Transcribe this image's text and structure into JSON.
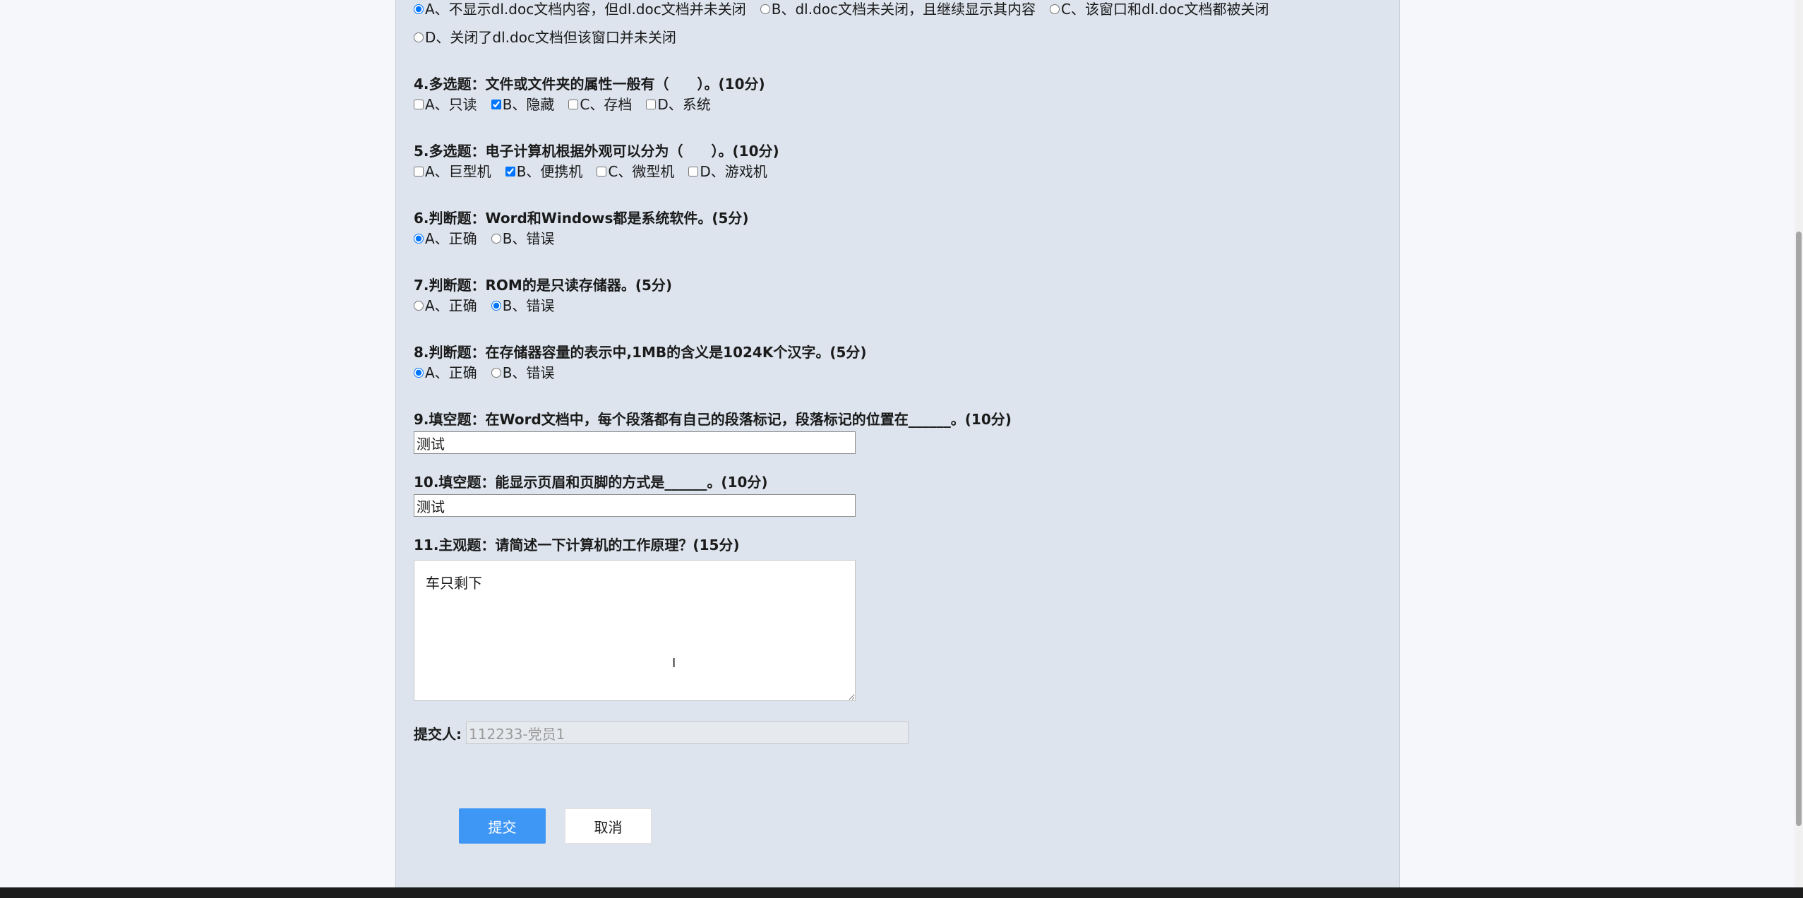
{
  "questions": [
    {
      "type": "radio",
      "title": "",
      "options": [
        {
          "label": "A、不显示dl.doc文档内容，但dl.doc文档并未关闭",
          "checked": true
        },
        {
          "label": "B、dl.doc文档未关闭，且继续显示其内容",
          "checked": false
        },
        {
          "label": "C、该窗口和dl.doc文档都被关闭",
          "checked": false
        }
      ]
    },
    {
      "type": "radio",
      "title": "",
      "options": [
        {
          "label": "D、关闭了dl.doc文档但该窗口并未关闭",
          "checked": false
        }
      ]
    },
    {
      "type": "checkbox",
      "title": "4.多选题：文件或文件夹的属性一般有（　　）。(10分)",
      "options": [
        {
          "label": "A、只读",
          "checked": false
        },
        {
          "label": "B、隐藏",
          "checked": true
        },
        {
          "label": "C、存档",
          "checked": false
        },
        {
          "label": "D、系统",
          "checked": false
        }
      ]
    },
    {
      "type": "checkbox",
      "title": "5.多选题：电子计算机根据外观可以分为（　　）。(10分)",
      "options": [
        {
          "label": "A、巨型机",
          "checked": false
        },
        {
          "label": "B、便携机",
          "checked": true
        },
        {
          "label": "C、微型机",
          "checked": false
        },
        {
          "label": "D、游戏机",
          "checked": false
        }
      ]
    },
    {
      "type": "radio",
      "title": "6.判断题：Word和Windows都是系统软件。(5分)",
      "options": [
        {
          "label": "A、正确",
          "checked": true
        },
        {
          "label": "B、错误",
          "checked": false
        }
      ]
    },
    {
      "type": "radio",
      "title": "7.判断题：ROM的是只读存储器。(5分)",
      "options": [
        {
          "label": "A、正确",
          "checked": false
        },
        {
          "label": "B、错误",
          "checked": true
        }
      ]
    },
    {
      "type": "radio",
      "title": "8.判断题：在存储器容量的表示中,1MB的含义是1024K个汉字。(5分)",
      "options": [
        {
          "label": "A、正确",
          "checked": true
        },
        {
          "label": "B、错误",
          "checked": false
        }
      ]
    }
  ],
  "fill_questions": [
    {
      "title": "9.填空题：在Word文档中，每个段落都有自己的段落标记，段落标记的位置在______。(10分)",
      "value": "测试"
    },
    {
      "title": "10.填空题：能显示页眉和页脚的方式是______。(10分)",
      "value": "测试"
    }
  ],
  "essay": {
    "title": "11.主观题：请简述一下计算机的工作原理？(15分)",
    "value": "车只剩下"
  },
  "submitter": {
    "label": "提交人:",
    "value": "112233-党员1"
  },
  "buttons": {
    "submit": "提交",
    "cancel": "取消"
  },
  "colors": {
    "panel_bg": "#dde4ee",
    "page_bg": "#f5f7fa",
    "submit_bg": "#3f97f5"
  }
}
